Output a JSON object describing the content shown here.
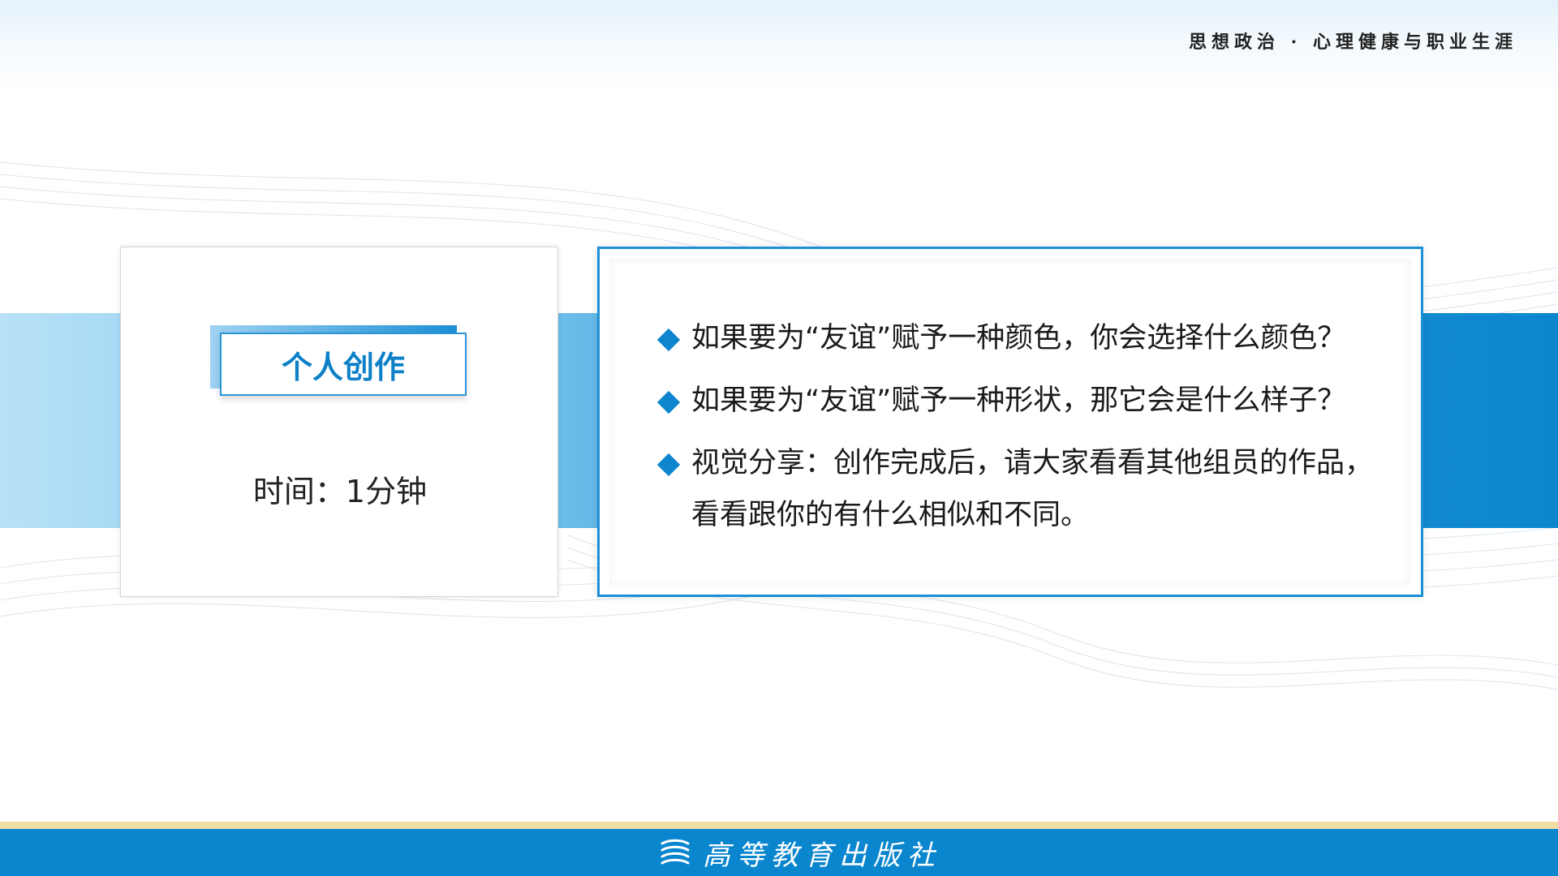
{
  "header": {
    "title": "思想政治 · 心理健康与职业生涯"
  },
  "left_card": {
    "badge_label": "个人创作",
    "time_text": "时间：1分钟"
  },
  "right_card": {
    "bullets": [
      {
        "text": "如果要为“友谊”赋予一种颜色，你会选择什么颜色？"
      },
      {
        "text": "如果要为“友谊”赋予一种形状，那它会是什么样子？"
      },
      {
        "text": "视觉分享：创作完成后，请大家看看其他组员的作品，看看跟你的有什么相似和不同。"
      }
    ]
  },
  "footer": {
    "publisher": "高等教育出版社",
    "publisher_icon": "book-stack-icon"
  },
  "colors": {
    "accent_blue": "#0a86cf",
    "light_blue": "#b8e1f7",
    "footer_stripe": "#f1dea7",
    "badge_text": "#0d80c8"
  }
}
